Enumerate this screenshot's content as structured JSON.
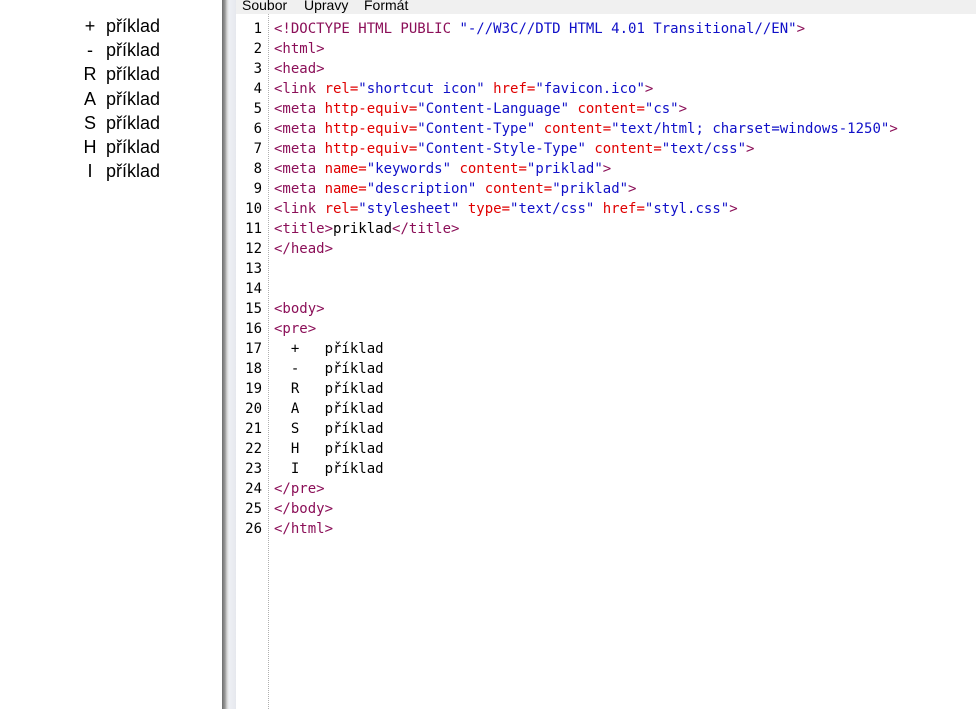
{
  "preview": {
    "items": [
      {
        "symbol": "+",
        "text": "příklad"
      },
      {
        "symbol": "-",
        "text": "příklad"
      },
      {
        "symbol": "R",
        "text": "příklad"
      },
      {
        "symbol": "A",
        "text": "příklad"
      },
      {
        "symbol": "S",
        "text": "příklad"
      },
      {
        "symbol": "H",
        "text": "příklad"
      },
      {
        "symbol": "I",
        "text": "příklad"
      }
    ]
  },
  "menu": {
    "items": [
      "Soubor",
      "Úpravy",
      "Formát"
    ]
  },
  "colors": {
    "tag": "#8b0f58",
    "attribute": "#e00000",
    "value": "#1010c8",
    "text": "#000000"
  },
  "code_lines": [
    [
      {
        "t": "tag",
        "s": "<!DOCTYPE HTML PUBLIC "
      },
      {
        "t": "val",
        "s": "\"-//W3C//DTD HTML 4.01 Transitional//EN\""
      },
      {
        "t": "tag",
        "s": ">"
      }
    ],
    [
      {
        "t": "tag",
        "s": "<html>"
      }
    ],
    [
      {
        "t": "tag",
        "s": "<head>"
      }
    ],
    [
      {
        "t": "tag",
        "s": "<link "
      },
      {
        "t": "attr",
        "s": "rel="
      },
      {
        "t": "val",
        "s": "\"shortcut icon\" "
      },
      {
        "t": "attr",
        "s": "href="
      },
      {
        "t": "val",
        "s": "\"favicon.ico\""
      },
      {
        "t": "tag",
        "s": ">"
      }
    ],
    [
      {
        "t": "tag",
        "s": "<meta "
      },
      {
        "t": "attr",
        "s": "http-equiv="
      },
      {
        "t": "val",
        "s": "\"Content-Language\" "
      },
      {
        "t": "attr",
        "s": "content="
      },
      {
        "t": "val",
        "s": "\"cs\""
      },
      {
        "t": "tag",
        "s": ">"
      }
    ],
    [
      {
        "t": "tag",
        "s": "<meta "
      },
      {
        "t": "attr",
        "s": "http-equiv="
      },
      {
        "t": "val",
        "s": "\"Content-Type\" "
      },
      {
        "t": "attr",
        "s": "content="
      },
      {
        "t": "val",
        "s": "\"text/html; charset=windows-1250\""
      },
      {
        "t": "tag",
        "s": ">"
      }
    ],
    [
      {
        "t": "tag",
        "s": "<meta "
      },
      {
        "t": "attr",
        "s": "http-equiv="
      },
      {
        "t": "val",
        "s": "\"Content-Style-Type\" "
      },
      {
        "t": "attr",
        "s": "content="
      },
      {
        "t": "val",
        "s": "\"text/css\""
      },
      {
        "t": "tag",
        "s": ">"
      }
    ],
    [
      {
        "t": "tag",
        "s": "<meta "
      },
      {
        "t": "attr",
        "s": "name="
      },
      {
        "t": "val",
        "s": "\"keywords\" "
      },
      {
        "t": "attr",
        "s": "content="
      },
      {
        "t": "val",
        "s": "\"priklad\""
      },
      {
        "t": "tag",
        "s": ">"
      }
    ],
    [
      {
        "t": "tag",
        "s": "<meta "
      },
      {
        "t": "attr",
        "s": "name="
      },
      {
        "t": "val",
        "s": "\"description\" "
      },
      {
        "t": "attr",
        "s": "content="
      },
      {
        "t": "val",
        "s": "\"priklad\""
      },
      {
        "t": "tag",
        "s": ">"
      }
    ],
    [
      {
        "t": "tag",
        "s": "<link "
      },
      {
        "t": "attr",
        "s": "rel="
      },
      {
        "t": "val",
        "s": "\"stylesheet\" "
      },
      {
        "t": "attr",
        "s": "type="
      },
      {
        "t": "val",
        "s": "\"text/css\" "
      },
      {
        "t": "attr",
        "s": "href="
      },
      {
        "t": "val",
        "s": "\"styl.css\""
      },
      {
        "t": "tag",
        "s": ">"
      }
    ],
    [
      {
        "t": "tag",
        "s": "<title>"
      },
      {
        "t": "text",
        "s": "priklad"
      },
      {
        "t": "tag",
        "s": "</title>"
      }
    ],
    [
      {
        "t": "tag",
        "s": "</head>"
      }
    ],
    [],
    [],
    [
      {
        "t": "tag",
        "s": "<body>"
      }
    ],
    [
      {
        "t": "tag",
        "s": "<pre>"
      }
    ],
    [
      {
        "t": "text",
        "s": "  +   příklad"
      }
    ],
    [
      {
        "t": "text",
        "s": "  -   příklad"
      }
    ],
    [
      {
        "t": "text",
        "s": "  R   příklad"
      }
    ],
    [
      {
        "t": "text",
        "s": "  A   příklad"
      }
    ],
    [
      {
        "t": "text",
        "s": "  S   příklad"
      }
    ],
    [
      {
        "t": "text",
        "s": "  H   příklad"
      }
    ],
    [
      {
        "t": "text",
        "s": "  I   příklad"
      }
    ],
    [
      {
        "t": "tag",
        "s": "</pre>"
      }
    ],
    [
      {
        "t": "tag",
        "s": "</body>"
      }
    ],
    [
      {
        "t": "tag",
        "s": "</html>"
      }
    ]
  ]
}
